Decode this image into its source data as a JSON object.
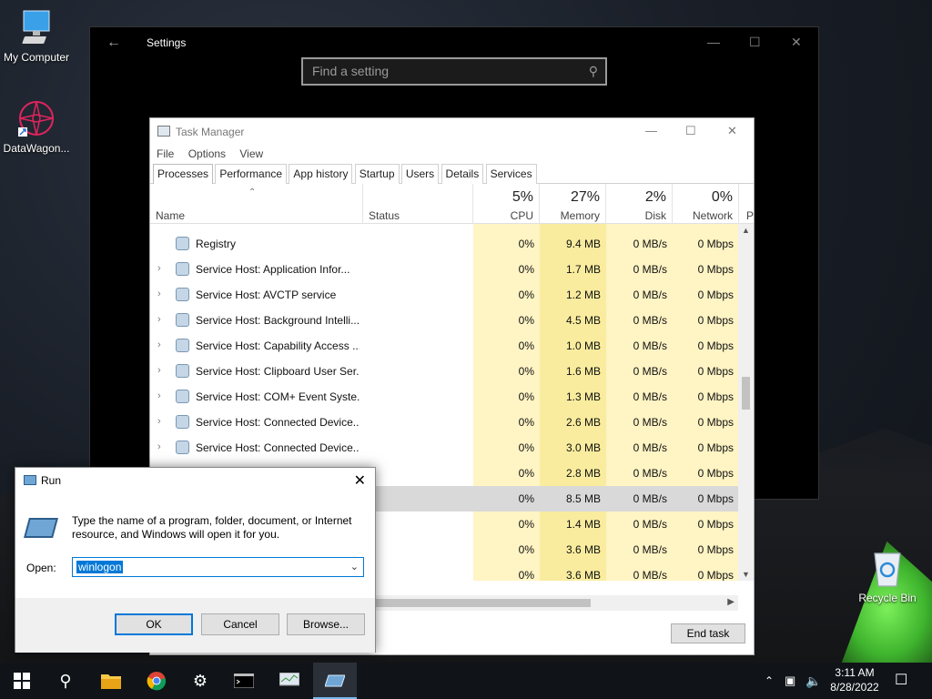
{
  "desktop": {
    "icons": [
      {
        "label": "My Computer"
      },
      {
        "label": "DataWagon..."
      },
      {
        "label": "Recycle Bin"
      }
    ]
  },
  "settings": {
    "title": "Settings",
    "search_placeholder": "Find a setting"
  },
  "task_manager": {
    "title": "Task Manager",
    "menu": [
      "File",
      "Options",
      "View"
    ],
    "tabs": [
      "Processes",
      "Performance",
      "App history",
      "Startup",
      "Users",
      "Details",
      "Services"
    ],
    "active_tab": "Processes",
    "columns": {
      "name": "Name",
      "status": "Status",
      "cpu": {
        "pct": "5%",
        "label": "CPU"
      },
      "memory": {
        "pct": "27%",
        "label": "Memory"
      },
      "disk": {
        "pct": "2%",
        "label": "Disk"
      },
      "network": {
        "pct": "0%",
        "label": "Network"
      },
      "power": "P"
    },
    "rows": [
      {
        "name": "Registry",
        "cpu": "0%",
        "memory": "9.4 MB",
        "disk": "0 MB/s",
        "network": "0 Mbps"
      },
      {
        "name": "Service Host: Application Infor...",
        "cpu": "0%",
        "memory": "1.7 MB",
        "disk": "0 MB/s",
        "network": "0 Mbps"
      },
      {
        "name": "Service Host: AVCTP service",
        "cpu": "0%",
        "memory": "1.2 MB",
        "disk": "0 MB/s",
        "network": "0 Mbps"
      },
      {
        "name": "Service Host: Background Intelli...",
        "cpu": "0%",
        "memory": "4.5 MB",
        "disk": "0 MB/s",
        "network": "0 Mbps"
      },
      {
        "name": "Service Host: Capability Access ...",
        "cpu": "0%",
        "memory": "1.0 MB",
        "disk": "0 MB/s",
        "network": "0 Mbps"
      },
      {
        "name": "Service Host: Clipboard User Ser...",
        "cpu": "0%",
        "memory": "1.6 MB",
        "disk": "0 MB/s",
        "network": "0 Mbps"
      },
      {
        "name": "Service Host: COM+ Event Syste...",
        "cpu": "0%",
        "memory": "1.3 MB",
        "disk": "0 MB/s",
        "network": "0 Mbps"
      },
      {
        "name": "Service Host: Connected Device...",
        "cpu": "0%",
        "memory": "2.6 MB",
        "disk": "0 MB/s",
        "network": "0 Mbps"
      },
      {
        "name": "Service Host: Connected Device...",
        "cpu": "0%",
        "memory": "3.0 MB",
        "disk": "0 MB/s",
        "network": "0 Mbps"
      },
      {
        "name": "",
        "cpu": "0%",
        "memory": "2.8 MB",
        "disk": "0 MB/s",
        "network": "0 Mbps"
      },
      {
        "name": "",
        "cpu": "0%",
        "memory": "8.5 MB",
        "disk": "0 MB/s",
        "network": "0 Mbps"
      },
      {
        "name": "",
        "cpu": "0%",
        "memory": "1.4 MB",
        "disk": "0 MB/s",
        "network": "0 Mbps"
      },
      {
        "name": "",
        "cpu": "0%",
        "memory": "3.6 MB",
        "disk": "0 MB/s",
        "network": "0 Mbps"
      },
      {
        "name": "",
        "cpu": "0%",
        "memory": "3.6 MB",
        "disk": "0 MB/s",
        "network": "0 Mbps"
      }
    ],
    "selected_row": 10,
    "end_task_label": "End task"
  },
  "run_dialog": {
    "title": "Run",
    "description": "Type the name of a program, folder, document, or Internet resource, and Windows will open it for you.",
    "open_label": "Open:",
    "open_value": "winlogon",
    "ok_label": "OK",
    "cancel_label": "Cancel",
    "browse_label": "Browse..."
  },
  "taskbar": {
    "time": "3:11 AM",
    "date": "8/28/2022"
  },
  "colors": {
    "accent": "#0078d7",
    "heat_column": "#fff4c4",
    "taskbar": "#101418"
  }
}
